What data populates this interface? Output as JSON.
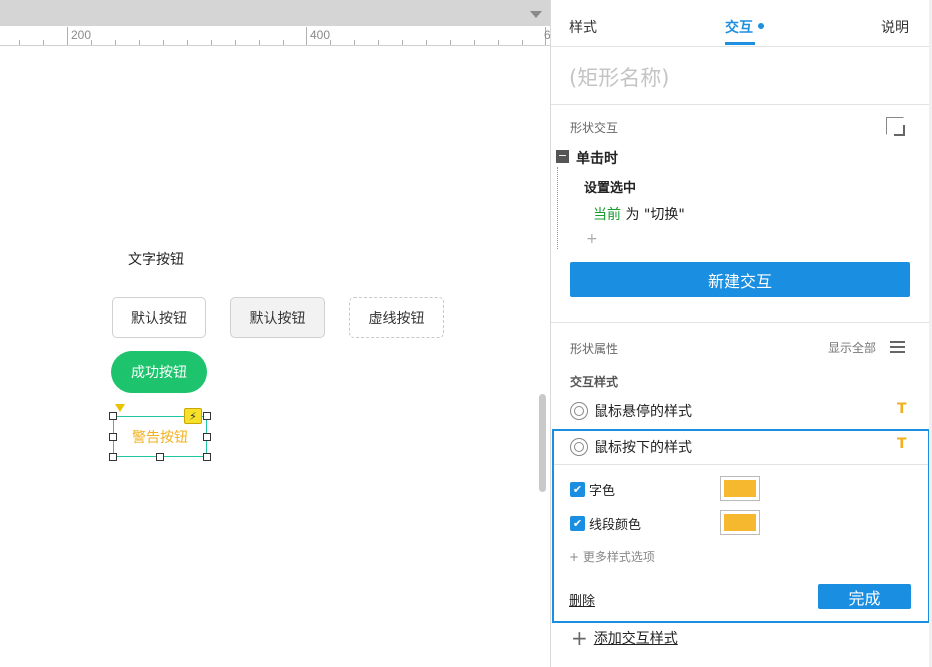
{
  "ruler": {
    "labels": [
      "200",
      "400",
      "6"
    ]
  },
  "canvas": {
    "text_label": "文字按钮",
    "buttons": {
      "default_1": "默认按钮",
      "default_2": "默认按钮",
      "dashed": "虚线按钮",
      "success": "成功按钮",
      "warning": "警告按钮"
    },
    "colors": {
      "success": "#1dc46d",
      "warning_text": "#f2b01e",
      "selection": "#23c6a3"
    }
  },
  "panel": {
    "tabs": {
      "style": "样式",
      "interaction": "交互",
      "help": "说明"
    },
    "shape_name_placeholder": "(矩形名称)",
    "interactions": {
      "title": "形状交互",
      "event": "单击时",
      "action": "设置选中",
      "target": "当前",
      "value_text": " 为 \"切换\"",
      "add_plus": "+",
      "new_button": "新建交互"
    },
    "properties": {
      "title": "形状属性",
      "show_all": "显示全部",
      "sub_title": "交互样式",
      "hover_style": "鼠标悬停的样式",
      "mousedown_style": "鼠标按下的样式",
      "badge": "T",
      "options": [
        {
          "label": "字色",
          "checked": true,
          "color": "#f5b82e"
        },
        {
          "label": "线段颜色",
          "checked": true,
          "color": "#f5b82e"
        }
      ],
      "more_options": "+ 更多样式选项",
      "delete": "删除",
      "done": "完成",
      "add_style": "添加交互样式"
    },
    "accent": "#1a8ee0"
  }
}
